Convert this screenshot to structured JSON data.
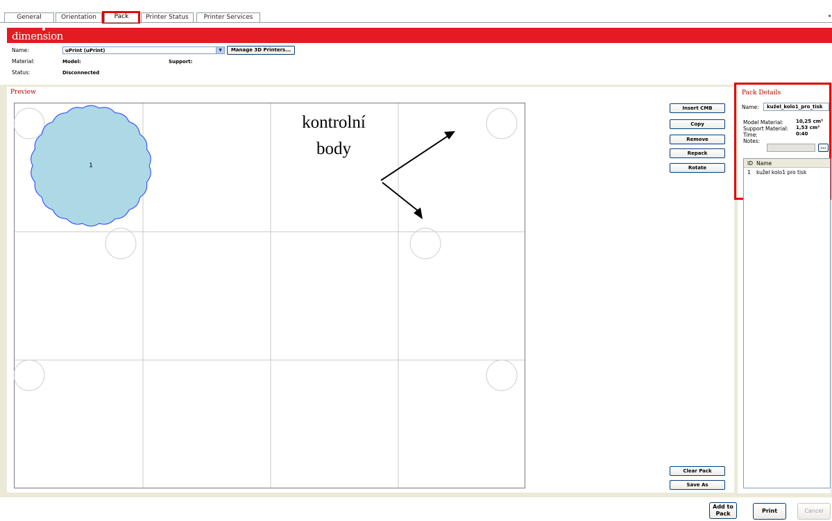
{
  "tabs": [
    {
      "label": "General"
    },
    {
      "label": "Orientation"
    },
    {
      "label": "Pack"
    },
    {
      "label": "Printer Status"
    },
    {
      "label": "Printer Services"
    }
  ],
  "header": {
    "brand": "dimension",
    "name_label": "Name:",
    "printer_value": "uPrint (uPrint)",
    "manage_button": "Manage 3D Printers...",
    "material_label": "Material:",
    "model_label": "Model:",
    "support_label": "Support:",
    "status_label": "Status:",
    "status_value": "Disconnected"
  },
  "preview": {
    "title": "Preview",
    "part_label": "1",
    "annotation_line1": "kontrolní",
    "annotation_line2": "body"
  },
  "actions": {
    "insert": "Insert CMB",
    "copy": "Copy",
    "remove": "Remove",
    "repack": "Repack",
    "rotate": "Rotate",
    "clear": "Clear Pack",
    "save_as": "Save As"
  },
  "pack_details": {
    "title": "Pack Details",
    "name_label": "Name:",
    "name_value": "kužel_kolo1_pro_tisk",
    "model_material_label": "Model Material:",
    "model_material_value": "10,25 cm³",
    "support_material_label": "Support Material:",
    "support_material_value": "1,53 cm³",
    "time_label": "Time:",
    "time_value": "0:40",
    "notes_label": "Notes:",
    "notes_button": "...",
    "col_id": "ID",
    "col_name": "Name",
    "rows": [
      {
        "id": "1",
        "name": "kužel kolo1 pro tisk"
      }
    ]
  },
  "footer": {
    "add_to_pack_line1": "Add to",
    "add_to_pack_line2": "Pack",
    "print": "Print",
    "cancel": "Cancel"
  },
  "colors": {
    "accent_red": "#e41b23",
    "highlight_red": "#e30000",
    "part_fill": "#add8e6",
    "part_outline": "#1e3cff"
  }
}
